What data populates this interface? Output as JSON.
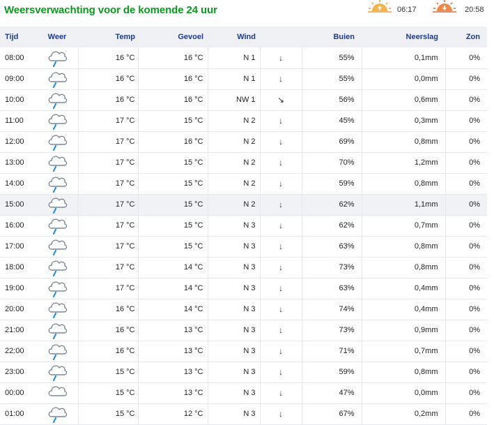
{
  "page": {
    "title": "Weersverwachting voor de komende 24 uur",
    "sunrise": "06:17",
    "sunset": "20:58",
    "colors": {
      "title": "#0a9a1e",
      "header_text": "#1d3b8a",
      "sun_icon": "#f0a030"
    }
  },
  "table": {
    "headers": {
      "tijd": "Tijd",
      "weer": "Weer",
      "temp": "Temp",
      "gevoel": "Gevoel",
      "wind": "Wind",
      "buien": "Buien",
      "neerslag": "Neerslag",
      "zon": "Zon"
    },
    "rows": [
      {
        "tijd": "08:00",
        "icon": "cloud-rain-icon",
        "temp": "16 °C",
        "gevoel": "16 °C",
        "wind": "N 1",
        "arrow": "↓",
        "buien": "55%",
        "neerslag": "0,1mm",
        "zon": "0%"
      },
      {
        "tijd": "09:00",
        "icon": "cloud-rain-icon",
        "temp": "16 °C",
        "gevoel": "16 °C",
        "wind": "N 1",
        "arrow": "↓",
        "buien": "55%",
        "neerslag": "0,0mm",
        "zon": "0%"
      },
      {
        "tijd": "10:00",
        "icon": "cloud-rain-icon",
        "temp": "16 °C",
        "gevoel": "16 °C",
        "wind": "NW 1",
        "arrow": "↘",
        "buien": "56%",
        "neerslag": "0,6mm",
        "zon": "0%"
      },
      {
        "tijd": "11:00",
        "icon": "cloud-rain-icon",
        "temp": "17 °C",
        "gevoel": "15 °C",
        "wind": "N 2",
        "arrow": "↓",
        "buien": "45%",
        "neerslag": "0,3mm",
        "zon": "0%"
      },
      {
        "tijd": "12:00",
        "icon": "cloud-rain-icon",
        "temp": "17 °C",
        "gevoel": "16 °C",
        "wind": "N 2",
        "arrow": "↓",
        "buien": "69%",
        "neerslag": "0,8mm",
        "zon": "0%"
      },
      {
        "tijd": "13:00",
        "icon": "cloud-rain-icon",
        "temp": "17 °C",
        "gevoel": "15 °C",
        "wind": "N 2",
        "arrow": "↓",
        "buien": "70%",
        "neerslag": "1,2mm",
        "zon": "0%"
      },
      {
        "tijd": "14:00",
        "icon": "cloud-rain-icon",
        "temp": "17 °C",
        "gevoel": "15 °C",
        "wind": "N 2",
        "arrow": "↓",
        "buien": "59%",
        "neerslag": "0,8mm",
        "zon": "0%"
      },
      {
        "tijd": "15:00",
        "icon": "cloud-rain-icon",
        "temp": "17 °C",
        "gevoel": "15 °C",
        "wind": "N 2",
        "arrow": "↓",
        "buien": "62%",
        "neerslag": "1,1mm",
        "zon": "0%"
      },
      {
        "tijd": "16:00",
        "icon": "cloud-rain-icon",
        "temp": "17 °C",
        "gevoel": "15 °C",
        "wind": "N 3",
        "arrow": "↓",
        "buien": "62%",
        "neerslag": "0,7mm",
        "zon": "0%"
      },
      {
        "tijd": "17:00",
        "icon": "cloud-rain-icon",
        "temp": "17 °C",
        "gevoel": "15 °C",
        "wind": "N 3",
        "arrow": "↓",
        "buien": "63%",
        "neerslag": "0,8mm",
        "zon": "0%"
      },
      {
        "tijd": "18:00",
        "icon": "cloud-rain-icon",
        "temp": "17 °C",
        "gevoel": "14 °C",
        "wind": "N 3",
        "arrow": "↓",
        "buien": "73%",
        "neerslag": "0,8mm",
        "zon": "0%"
      },
      {
        "tijd": "19:00",
        "icon": "cloud-rain-icon",
        "temp": "17 °C",
        "gevoel": "14 °C",
        "wind": "N 3",
        "arrow": "↓",
        "buien": "63%",
        "neerslag": "0,4mm",
        "zon": "0%"
      },
      {
        "tijd": "20:00",
        "icon": "cloud-rain-icon",
        "temp": "16 °C",
        "gevoel": "14 °C",
        "wind": "N 3",
        "arrow": "↓",
        "buien": "74%",
        "neerslag": "0,4mm",
        "zon": "0%"
      },
      {
        "tijd": "21:00",
        "icon": "cloud-rain-icon",
        "temp": "16 °C",
        "gevoel": "13 °C",
        "wind": "N 3",
        "arrow": "↓",
        "buien": "73%",
        "neerslag": "0,9mm",
        "zon": "0%"
      },
      {
        "tijd": "22:00",
        "icon": "cloud-rain-icon",
        "temp": "16 °C",
        "gevoel": "13 °C",
        "wind": "N 3",
        "arrow": "↓",
        "buien": "71%",
        "neerslag": "0,7mm",
        "zon": "0%"
      },
      {
        "tijd": "23:00",
        "icon": "cloud-rain-icon",
        "temp": "15 °C",
        "gevoel": "13 °C",
        "wind": "N 3",
        "arrow": "↓",
        "buien": "59%",
        "neerslag": "0,8mm",
        "zon": "0%"
      },
      {
        "tijd": "00:00",
        "icon": "cloud-icon",
        "temp": "15 °C",
        "gevoel": "13 °C",
        "wind": "N 3",
        "arrow": "↓",
        "buien": "47%",
        "neerslag": "0,0mm",
        "zon": "0%"
      },
      {
        "tijd": "01:00",
        "icon": "cloud-rain-icon",
        "temp": "15 °C",
        "gevoel": "12 °C",
        "wind": "N 3",
        "arrow": "↓",
        "buien": "67%",
        "neerslag": "0,2mm",
        "zon": "0%"
      }
    ]
  }
}
